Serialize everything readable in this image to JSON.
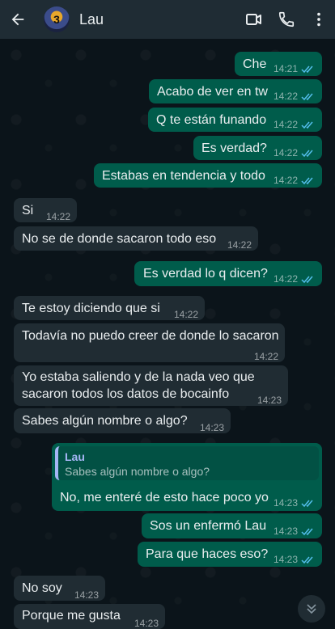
{
  "header": {
    "contact_name": "Lau",
    "avatar_text": "3"
  },
  "icons": {
    "back": "arrow-back-icon",
    "video": "video-call-icon",
    "call": "phone-icon",
    "menu": "more-vert-icon",
    "scroll": "double-chevron-down-icon"
  },
  "colors": {
    "header_bg": "#1f2c34",
    "chat_bg": "#0b141a",
    "outgoing_bubble": "#005c4b",
    "incoming_bubble": "#202c33",
    "read_ticks": "#53bdeb",
    "quote_author": "#a5b6f5"
  },
  "messages": [
    {
      "direction": "out",
      "text": "Che",
      "time": "14:21",
      "read": true
    },
    {
      "direction": "out",
      "text": "Acabo de ver en tw",
      "time": "14:22",
      "read": true
    },
    {
      "direction": "out",
      "text": "Q te están funando",
      "time": "14:22",
      "read": true
    },
    {
      "direction": "out",
      "text": "Es verdad?",
      "time": "14:22",
      "read": true
    },
    {
      "direction": "out",
      "text": "Estabas en tendencia y todo",
      "time": "14:22",
      "read": true
    },
    {
      "direction": "in",
      "text": "Si",
      "time": "14:22"
    },
    {
      "direction": "in",
      "text": "No se de donde sacaron todo eso",
      "time": "14:22"
    },
    {
      "direction": "out",
      "text": "Es verdad lo q dicen?",
      "time": "14:22",
      "read": true
    },
    {
      "direction": "in",
      "text": "Te estoy diciendo que si",
      "time": "14:22"
    },
    {
      "direction": "in",
      "text": "Todavía no puedo creer de donde lo sacaron",
      "time": "14:22"
    },
    {
      "direction": "in",
      "text_line1": "Yo estaba saliendo y de la nada veo que",
      "text_line2": "sacaron todos los datos de bocainfo",
      "time": "14:23"
    },
    {
      "direction": "in",
      "text": "Sabes algún nombre o algo?",
      "time": "14:23"
    },
    {
      "direction": "out",
      "quote_author": "Lau",
      "quote_text": "Sabes algún nombre o algo?",
      "text": "No, me enteré de esto hace poco yo",
      "time": "14:23",
      "read": true
    },
    {
      "direction": "out",
      "text": "Sos un enfermó Lau",
      "time": "14:23",
      "read": true
    },
    {
      "direction": "out",
      "text": "Para que haces eso?",
      "time": "14:23",
      "read": true
    },
    {
      "direction": "in",
      "text": "No soy",
      "time": "14:23"
    },
    {
      "direction": "in",
      "text": "Porque me gusta",
      "time": "14:23"
    }
  ]
}
